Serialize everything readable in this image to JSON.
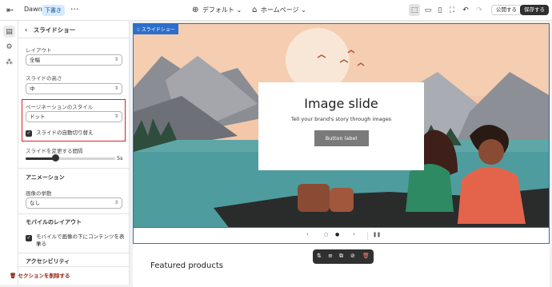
{
  "topbar": {
    "theme_name": "Dawn",
    "badge": "下書き",
    "template_select": "デフォルト",
    "page_select": "ホームページ",
    "publish_label": "公開する",
    "save_label": "保存する"
  },
  "panel": {
    "title": "スライドショー",
    "layout_label": "レイアウト",
    "layout_value": "全幅",
    "height_label": "スライドの高さ",
    "height_value": "中",
    "pagination_label": "ページネーションのスタイル",
    "pagination_value": "ドット",
    "autorotate_label": "スライドの自動切り替え",
    "interval_label": "スライドを変更する間隔",
    "interval_value": "5s",
    "interval_fraction": 0.33,
    "animation_heading": "アニメーション",
    "image_behavior_label": "画像の挙動",
    "image_behavior_value": "なし",
    "mobile_heading": "モバイルのレイアウト",
    "mobile_check_line1": "モバイルで画像の下にコンテンツを表示",
    "mobile_check_line2": "する",
    "accessibility_heading": "アクセシビリティ",
    "remove_label": "セクションを削除する"
  },
  "preview": {
    "tag": "スライドショー",
    "slide_title": "Image slide",
    "slide_subtitle": "Tell your brand's story through images",
    "slide_button": "Button label",
    "featured": "Featured products"
  },
  "colors": {
    "accent": "#2c6ecb",
    "highlight": "#e0201e",
    "dark": "#303030"
  }
}
